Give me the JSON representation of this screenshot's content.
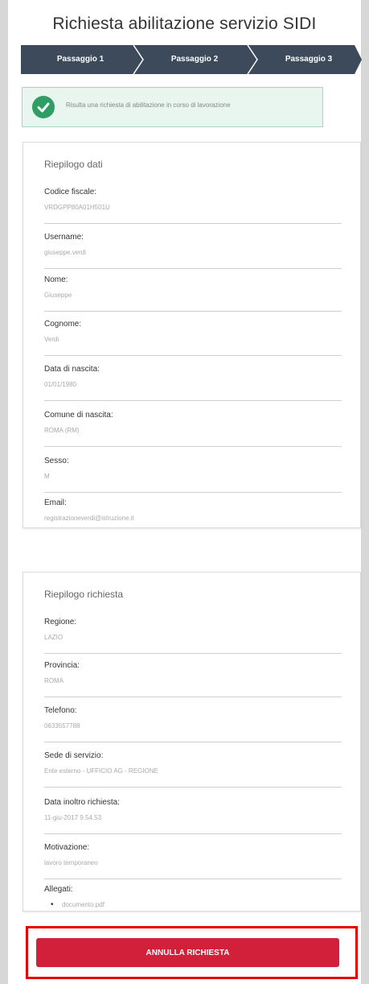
{
  "header": {
    "title": "Richiesta abilitazione servizio SIDI"
  },
  "stepper": {
    "steps": [
      "Passaggio 1",
      "Passaggio 2",
      "Passaggio 3"
    ]
  },
  "alert": {
    "message": "Risulta una richiesta di abilitazione in corso di lavorazione"
  },
  "dati": {
    "title": "Riepilogo dati",
    "fields": [
      {
        "label": "Codice fiscale:",
        "value": "VRDGPP80A01H501U"
      },
      {
        "label": "Username:",
        "value": "giuseppe.verdi"
      },
      {
        "label": "Nome:",
        "value": "Giuseppe"
      },
      {
        "label": "Cognome:",
        "value": "Verdi"
      },
      {
        "label": "Data di nascita:",
        "value": "01/01/1980"
      },
      {
        "label": "Comune di nascita:",
        "value": "ROMA (RM)"
      },
      {
        "label": "Sesso:",
        "value": "M"
      },
      {
        "label": "Email:",
        "value": "registrazioneverdi@istruzione.it"
      }
    ]
  },
  "richiesta": {
    "title": "Riepilogo richiesta",
    "fields": [
      {
        "label": "Regione:",
        "value": "LAZIO"
      },
      {
        "label": "Provincia:",
        "value": "ROMA"
      },
      {
        "label": "Telefono:",
        "value": "0633557788"
      },
      {
        "label": "Sede di servizio:",
        "value": "Ente esterno - UFFICIO AG - REGIONE"
      },
      {
        "label": "Data inoltro richiesta:",
        "value": "11-giu-2017 9.54.53"
      },
      {
        "label": "Motivazione:",
        "value": "lavoro temporaneo"
      }
    ],
    "attachments_label": "Allegati:",
    "attachments": [
      "documento.pdf"
    ]
  },
  "actions": {
    "cancel_label": "ANNULLA RICHIESTA"
  },
  "colors": {
    "stepper": "#3c4a5c",
    "accent_red": "#d21f3a",
    "success": "#2e9e63",
    "highlight": "#e60000"
  }
}
